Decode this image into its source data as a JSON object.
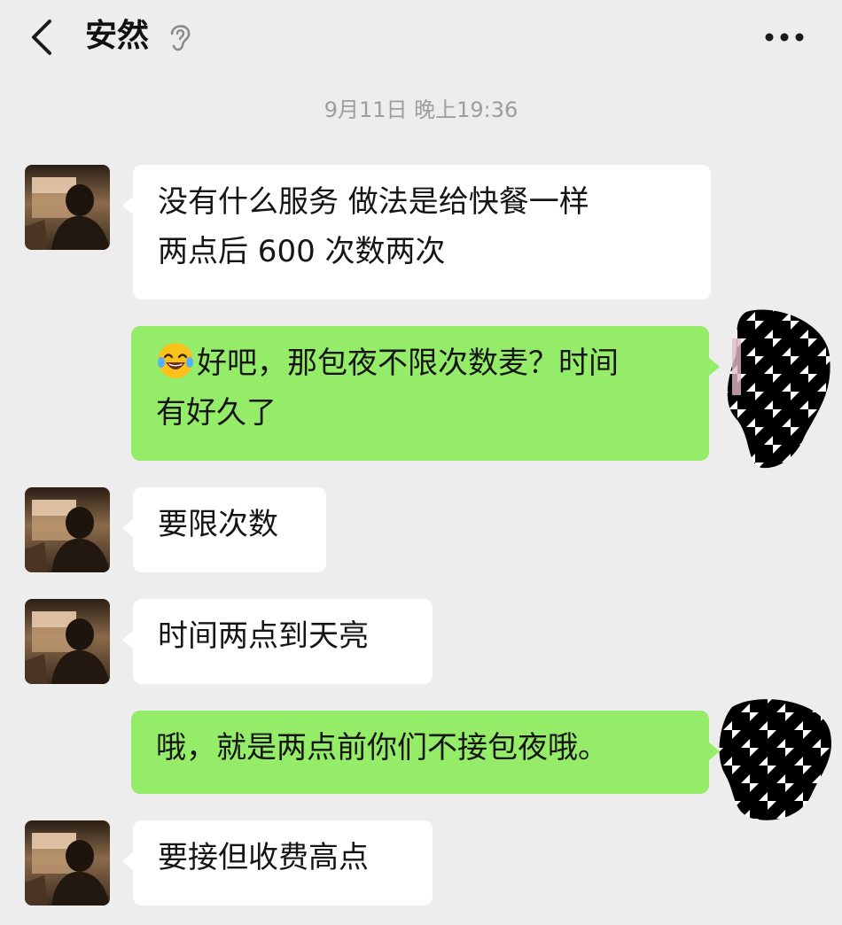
{
  "header": {
    "title": "安然",
    "back_icon": "chevron-left-icon",
    "ear_icon": "ear-icon",
    "more_icon": "more-dots-icon"
  },
  "timestamp": "9月11日 晚上19:36",
  "colors": {
    "background": "#ededed",
    "incoming_bubble": "#ffffff",
    "outgoing_bubble": "#95ec69",
    "timestamp_text": "#9d9d9d"
  },
  "messages": [
    {
      "from": "other",
      "text": "没有什么服务 做法是给快餐一样\n两点后 600 次数两次"
    },
    {
      "from": "self",
      "emoji": "face-with-tears-of-joy",
      "text": "好吧，那包夜不限次数麦？时间\n有好久了"
    },
    {
      "from": "other",
      "text": "要限次数"
    },
    {
      "from": "other",
      "text": "时间两点到天亮"
    },
    {
      "from": "self",
      "text": "哦，就是两点前你们不接包夜哦。"
    },
    {
      "from": "other",
      "text": "要接但收费高点"
    }
  ]
}
